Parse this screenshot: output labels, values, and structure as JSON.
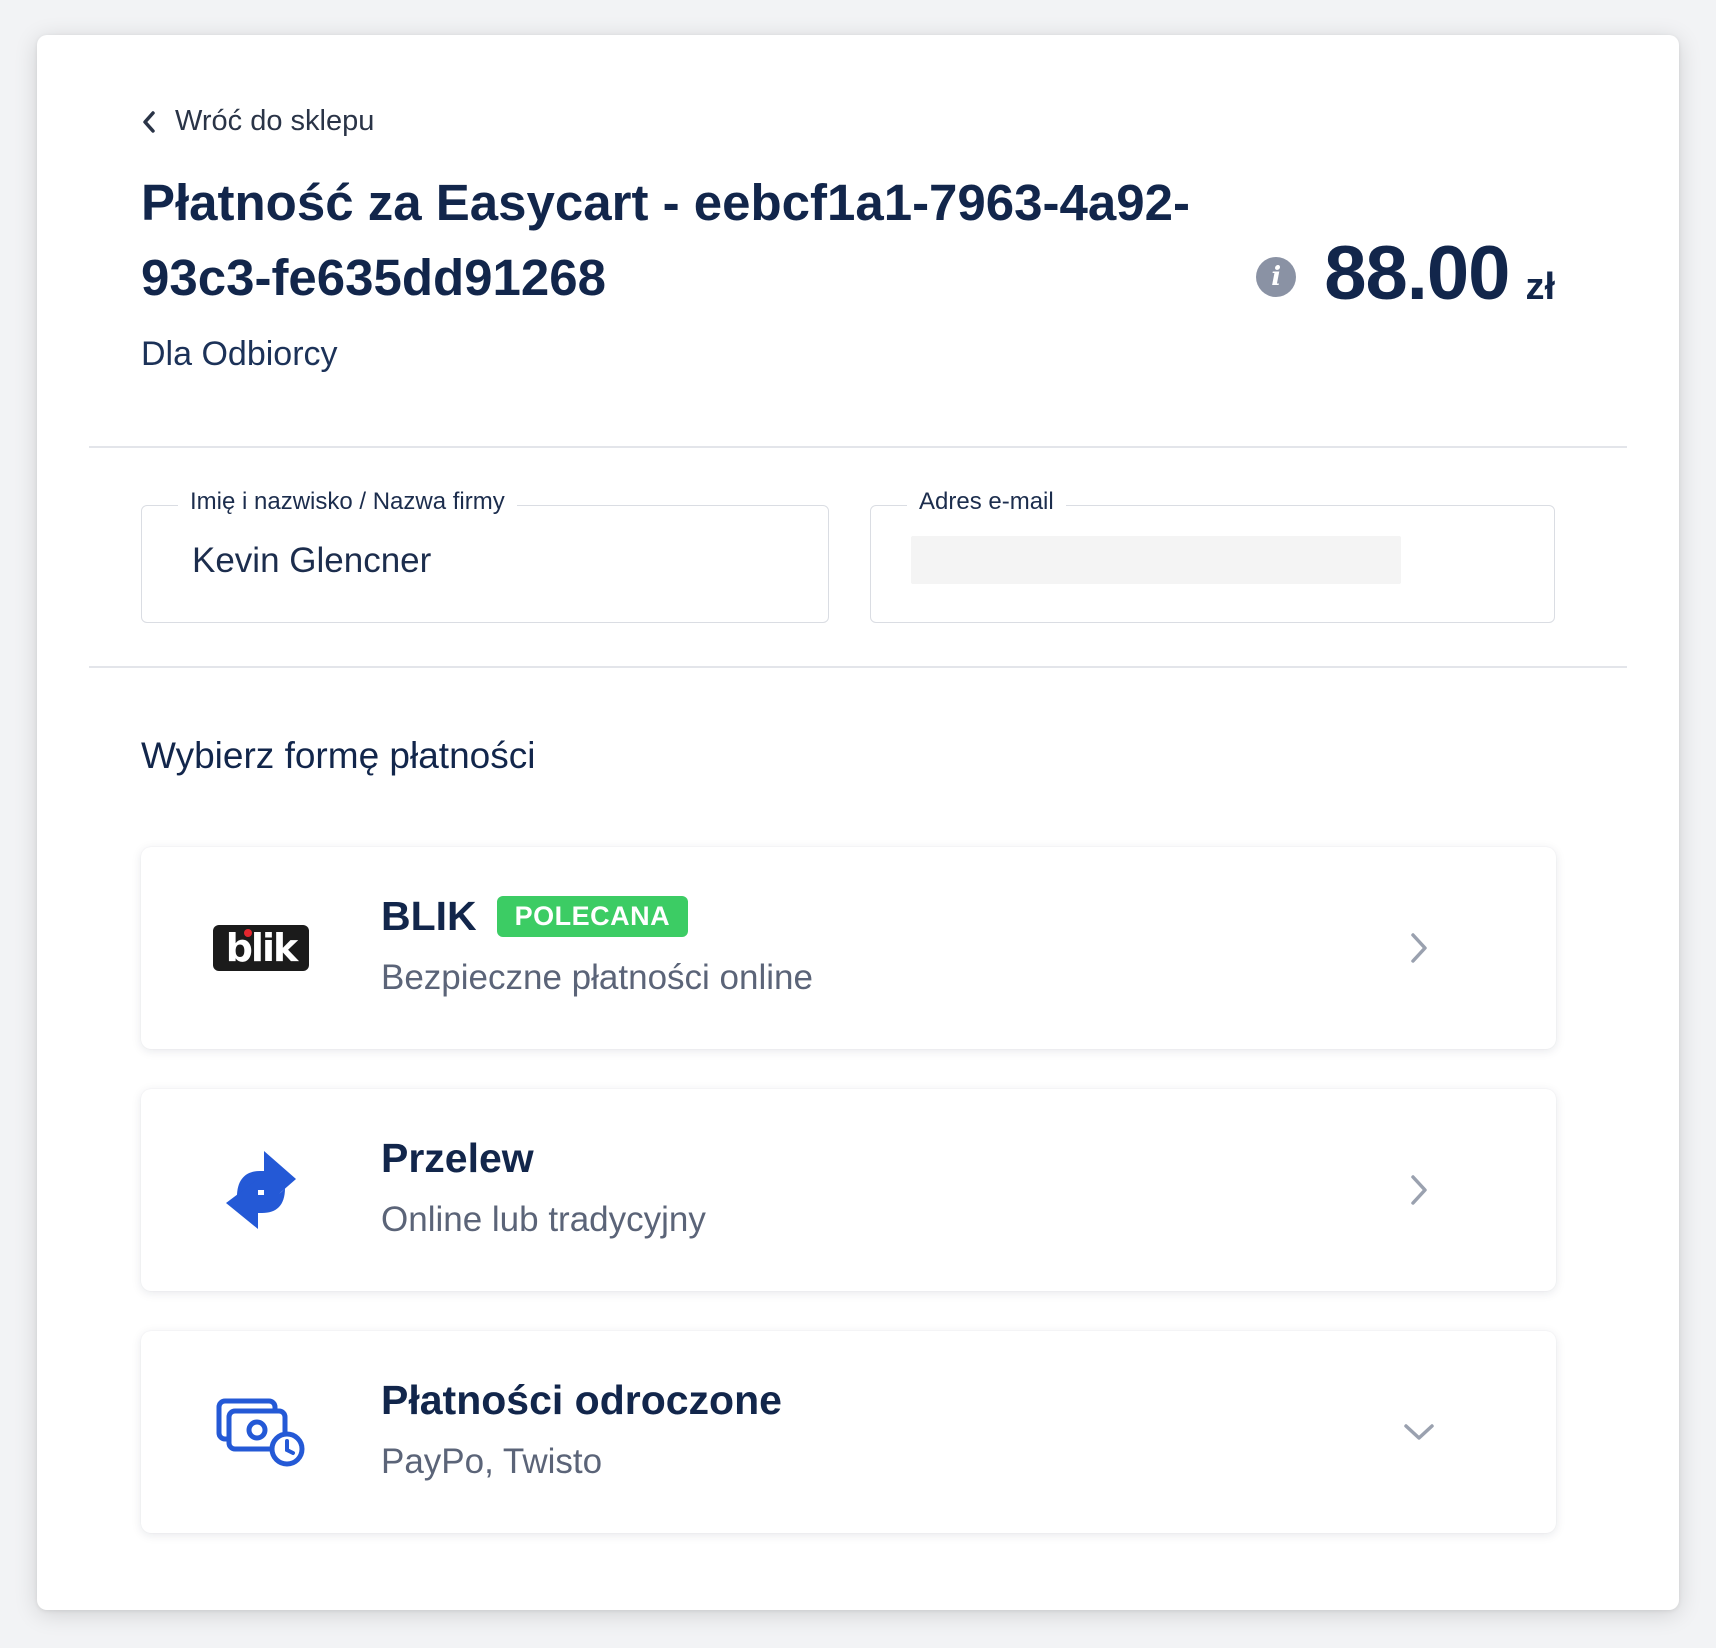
{
  "header": {
    "back_label": "Wróć do sklepu",
    "title": "Płatność za Easycart - eebcf1a1-7963-4a92-93c3-fe635dd91268",
    "subtitle": "Dla Odbiorcy",
    "price_amount": "88.00",
    "price_currency": "zł",
    "info_icon": "info-icon"
  },
  "form": {
    "name_label": "Imię i nazwisko / Nazwa firmy",
    "name_value": "Kevin Glencner",
    "email_label": "Adres e-mail",
    "email_value": ""
  },
  "payment": {
    "heading": "Wybierz formę płatności",
    "options": [
      {
        "title": "BLIK",
        "badge": "POLECANA",
        "subtitle": "Bezpieczne płatności online",
        "logo": "blik-logo",
        "logo_text": "blik",
        "chevron": "chevron-right-icon"
      },
      {
        "title": "Przelew",
        "subtitle": "Online lub tradycyjny",
        "logo": "transfer-arrows-icon",
        "chevron": "chevron-right-icon"
      },
      {
        "title": "Płatności odroczone",
        "subtitle": "PayPo, Twisto",
        "logo": "deferred-payment-icon",
        "chevron": "chevron-down-icon"
      }
    ]
  },
  "colors": {
    "primary_text": "#12264b",
    "secondary_text": "#5b6478",
    "badge_green": "#3ccc64",
    "icon_blue": "#2459d6",
    "info_grey": "#8a92a4"
  }
}
